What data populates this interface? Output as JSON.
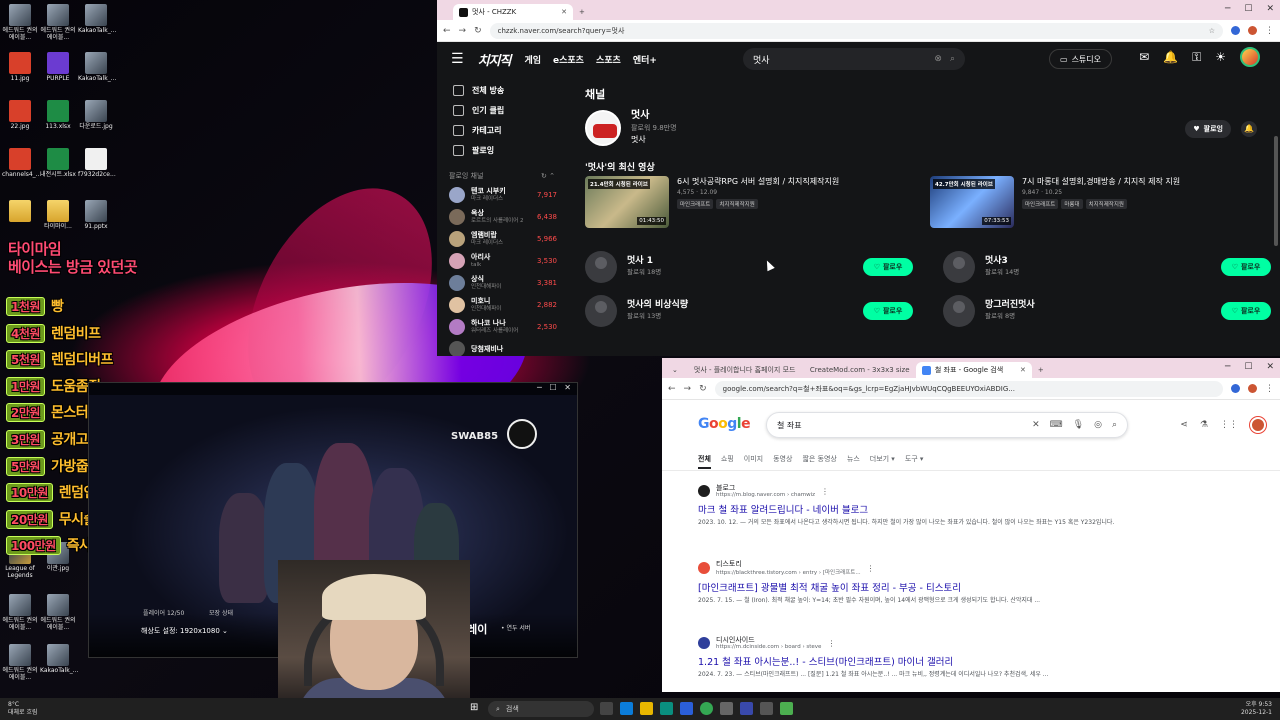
{
  "desktop": {
    "icons": [
      {
        "label": "에드워드 권의 에이블...",
        "type": "img"
      },
      {
        "label": "에드워드 권의 에이블...",
        "type": "img"
      },
      {
        "label": "KakaoTalk_...",
        "type": "img"
      },
      {
        "label": "11.jpg",
        "type": "app"
      },
      {
        "label": "PURPLE",
        "type": "purple"
      },
      {
        "label": "KakaoTalk_...",
        "type": "img"
      },
      {
        "label": "22.jpg",
        "type": "app"
      },
      {
        "label": "113.xlsx",
        "type": "xl"
      },
      {
        "label": "다운로드.jpg",
        "type": "img"
      },
      {
        "label": "channels4_...",
        "type": "app"
      },
      {
        "label": "내전시트.xlsx",
        "type": "xl"
      },
      {
        "label": "f7932d2ce...",
        "type": "doc"
      },
      {
        "label": "",
        "type": "folder"
      },
      {
        "label": "타이마이...",
        "type": "folder"
      },
      {
        "label": "91.pptx",
        "type": "img"
      },
      {
        "label": "League of Legends",
        "type": "lol"
      },
      {
        "label": "이관.jpg",
        "type": "img"
      },
      {
        "label": "에드워드 권의 에이블...",
        "type": "img"
      },
      {
        "label": "에드워드 권의 에이블...",
        "type": "img"
      },
      {
        "label": "에드워드 권의 에이블...",
        "type": "img"
      },
      {
        "label": "KakaoTalk_...",
        "type": "img"
      }
    ],
    "overlay_header": [
      "타이마임",
      "베이스는 방금 있던곳"
    ],
    "donations": [
      {
        "price": "1천원",
        "text": "빵"
      },
      {
        "price": "4천원",
        "text": "렌덤비프"
      },
      {
        "price": "5천원",
        "text": "렌덤디버프"
      },
      {
        "price": "1만원",
        "text": "도움좀줘"
      },
      {
        "price": "2만원",
        "text": "몬스터소환"
      },
      {
        "price": "3만원",
        "text": "공개고로시"
      },
      {
        "price": "5만원",
        "text": "가방줍기"
      },
      {
        "price": "10만원",
        "text": "렌덤인물 텔레포트"
      },
      {
        "price": "20만원",
        "text": "무시술 몬스터소환"
      },
      {
        "price": "100만원",
        "text": "즉사"
      }
    ]
  },
  "chzzk": {
    "tab_title": "멋사 - CHZZK",
    "url": "chzzk.naver.com/search?query=멋사",
    "logo": "치지직",
    "nav": [
      "게임",
      "e스포츠",
      "스포츠",
      "엔터+"
    ],
    "search_value": "멋사",
    "studio_label": "스튜디오",
    "sidebar": {
      "menu": [
        "전체 방송",
        "인기 클립",
        "카테고리",
        "팔로잉"
      ],
      "following_label": "팔로잉 채널",
      "channels": [
        {
          "name": "텐코 시부키",
          "sub": "마크 레이더스",
          "count": "7,917",
          "color": "#9aa6c9"
        },
        {
          "name": "옥상",
          "sub": "로르트의 사를레이어 2",
          "count": "6,438",
          "color": "#7a6a5a"
        },
        {
          "name": "엠램비랍",
          "sub": "마크 레이더스",
          "count": "5,966",
          "color": "#b9a27b"
        },
        {
          "name": "아리사",
          "sub": "talk",
          "count": "3,530",
          "color": "#d6a3b6"
        },
        {
          "name": "상식",
          "sub": "인천대해파이",
          "count": "3,381",
          "color": "#6d7e9a"
        },
        {
          "name": "미호니",
          "sub": "인천대해파이",
          "count": "2,882",
          "color": "#e0c2a2"
        },
        {
          "name": "하나코 나나",
          "sub": "워터레즈 사를레이어",
          "count": "2,530",
          "color": "#b37bc4"
        },
        {
          "name": "당첨재비나",
          "sub": "",
          "count": "",
          "color": "#555"
        }
      ]
    },
    "section_channel": "채널",
    "main_channel": {
      "name": "멋사",
      "followers": "팔로워 9.8만명",
      "desc": "멋사",
      "follow_label": "팔로잉"
    },
    "latest_title": "'멋사'의 최신 영상",
    "videos": [
      {
        "tag": "21.4만회 시청된 라이브",
        "duration": "01:43:50",
        "title": "6시 멋사공략RPG 서버 설명회 / 치지직제작지원",
        "meta": "4,575 · 12.09",
        "tags": [
          "마인크래프트",
          "치지직제작지원"
        ]
      },
      {
        "tag": "42.7만회 시청된 라이브",
        "duration": "07:33:53",
        "title": "7시 마롱대 설명회,경매방송 / 치지직 제작 지원",
        "meta": "9,847 · 10.25",
        "tags": [
          "마인크래프트",
          "마롱대",
          "치지직제작지원"
        ]
      }
    ],
    "channels": [
      {
        "name": "멋사 1",
        "followers": "팔로워 18명"
      },
      {
        "name": "멋사3",
        "followers": "팔로워 14명"
      },
      {
        "name": "멋사의 비상식량",
        "followers": "팔로워 13명"
      },
      {
        "name": "망그러진멋사",
        "followers": "팔로워 8명"
      }
    ],
    "follow_button": "팔로우"
  },
  "player": {
    "logo": "SWAB85",
    "players": "플레이어  12/50",
    "status": "모장 상태",
    "resolution": "해상도 설정:  1920x1080 ⌄",
    "play": "플레이",
    "server": "• 연두 서버"
  },
  "google": {
    "tabs": [
      {
        "title": "멋사 - 플레이합니다 홈페이지 모드",
        "color": "#333"
      },
      {
        "title": "CreateMod.com - 3x3x3 size",
        "color": "#7b4fd6"
      },
      {
        "title": "철 좌표 - Google 검색",
        "color": "#4285f4"
      }
    ],
    "url": "google.com/search?q=철+좌표&oq=&gs_lcrp=EgZjaHJvbWUqCQgBEEUYOxiABDIG...",
    "logo_letters": [
      "G",
      "o",
      "o",
      "g",
      "l",
      "e"
    ],
    "query": "철 좌표",
    "filters": [
      "전체",
      "쇼핑",
      "이미지",
      "동영상",
      "짧은 동영상",
      "뉴스",
      "더보기 ▾",
      "도구 ▾"
    ],
    "results": [
      {
        "site": "블로그",
        "url": "https://m.blog.naver.com › chamwiz",
        "title": "마크 철 좌표 알려드립니다 - 네이버 블로그",
        "snippet": "2023. 10. 12. — 거의 모든 좌표에서 나온다고 생각하시면 됩니다. 하지만 철이 가장 많이 나오는 좌표가 있습니다. 철이 많이 나오는 좌표는 Y15 혹은 Y232입니다.",
        "color": "#1e1e1e"
      },
      {
        "site": "티스토리",
        "url": "https://blackthree.tistory.com › entry › [마인크래프트...",
        "title": "[마인크래프트] 광물별 최적 채굴 높이 좌표 정리 - 부공 - 티스토리",
        "snippet": "2025. 7. 15. — 철 (Iron). 최적 채굴 높이: Y=14; 초반 필수 자원이며, 높이 14에서 광맥형으로 크게 생성되기도 합니다. 산악지대 ...",
        "color": "#e84e3a"
      },
      {
        "site": "디시인사이드",
        "url": "https://m.dcinside.com › board › steve",
        "title": "1.21 철 좌표 아시는분..! - 스티브(마인크래프트) 마이너 갤러리",
        "snippet": "2024. 7. 23. — 스티브(마인크래프트) ... [질문] 1.21 철 좌표 아시는분..! ... 마크 뉴비,, 정령계는데 이디서일나 나오? 추천검색, 세우 ...",
        "color": "#2f3f9b"
      }
    ]
  },
  "taskbar": {
    "weather_temp": "8°C",
    "weather_desc": "대체로 흐림",
    "search_placeholder": "검색",
    "time": "오후 9:53",
    "date": "2025-12-1"
  }
}
